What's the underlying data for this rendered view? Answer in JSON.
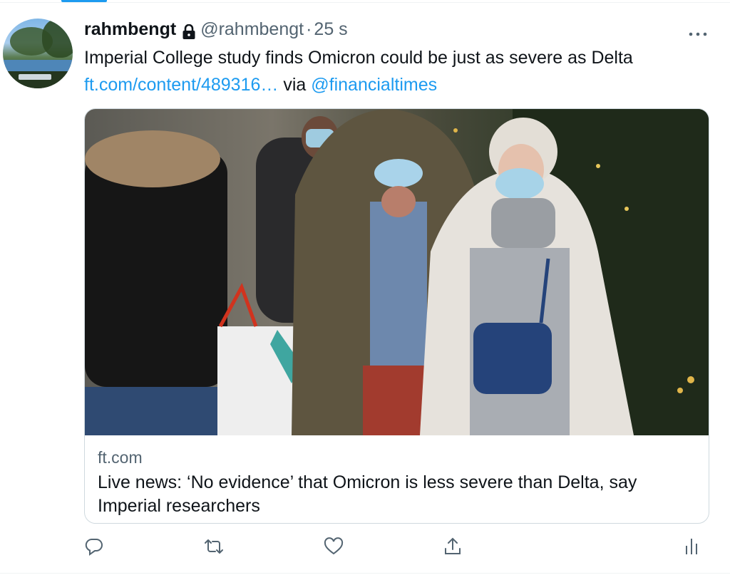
{
  "tweet": {
    "display_name": "rahmbengt",
    "handle": "@rahmbengt",
    "separator": "·",
    "time": "25 s",
    "text_line1": "Imperial College study finds Omicron could be just as severe as Delta",
    "link_text": "ft.com/content/489316…",
    "via_text": "via",
    "mention": "@financialtimes",
    "icons": {
      "lock": "lock-icon",
      "more": "more-icon",
      "reply": "reply-icon",
      "retweet": "retweet-icon",
      "like": "like-icon",
      "share": "share-icon",
      "analytics": "analytics-icon"
    }
  },
  "card": {
    "domain": "ft.com",
    "title": "Live news: ‘No evidence’ that Omicron is less severe than Delta, say Imperial researchers",
    "image_alt": "People wearing face masks walking on a street carrying shopping bags"
  },
  "colors": {
    "link": "#1d9bf0",
    "secondary_text": "#536471",
    "border": "#cfd9de"
  }
}
